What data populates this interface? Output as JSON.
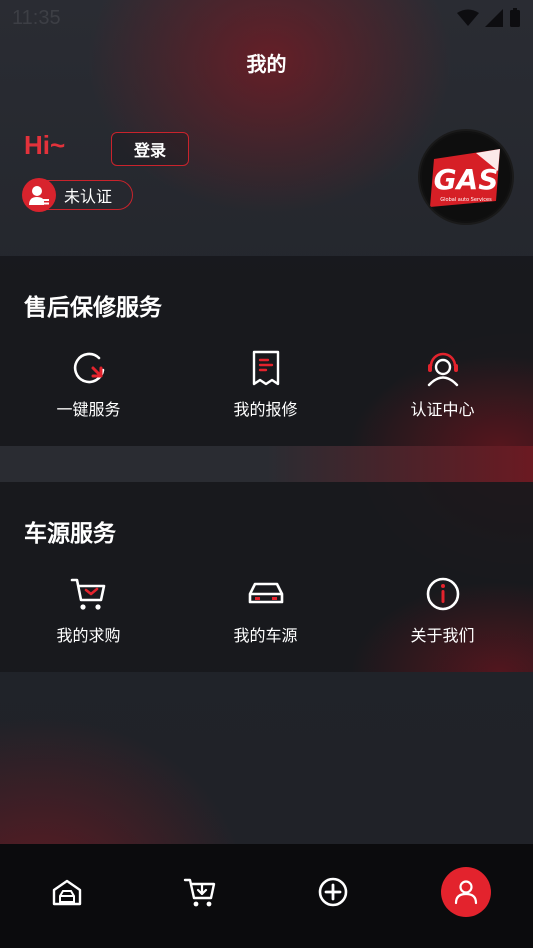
{
  "status_bar": {
    "time": "11:35"
  },
  "header": {
    "title": "我的"
  },
  "profile": {
    "greeting": "Hi~",
    "login_label": "登录",
    "cert_status": "未认证",
    "logo_text": "GAS",
    "logo_sub": "Global auto Services"
  },
  "after_sales": {
    "title": "售后保修服务",
    "items": [
      {
        "label": "一键服务",
        "icon": "refresh-arrow-icon"
      },
      {
        "label": "我的报修",
        "icon": "receipt-icon"
      },
      {
        "label": "认证中心",
        "icon": "headset-user-icon"
      }
    ]
  },
  "vehicle": {
    "title": "车源服务",
    "items": [
      {
        "label": "我的求购",
        "icon": "cart-icon"
      },
      {
        "label": "我的车源",
        "icon": "car-icon"
      },
      {
        "label": "关于我们",
        "icon": "info-icon"
      }
    ]
  },
  "tabbar": {
    "tabs": [
      {
        "icon": "car-home-icon"
      },
      {
        "icon": "cart-download-icon"
      },
      {
        "icon": "plus-circle-icon"
      },
      {
        "icon": "user-icon",
        "active": true
      }
    ]
  },
  "colors": {
    "accent": "#e3232d",
    "background": "#22252b",
    "tabbar": "#0b0b0d"
  }
}
